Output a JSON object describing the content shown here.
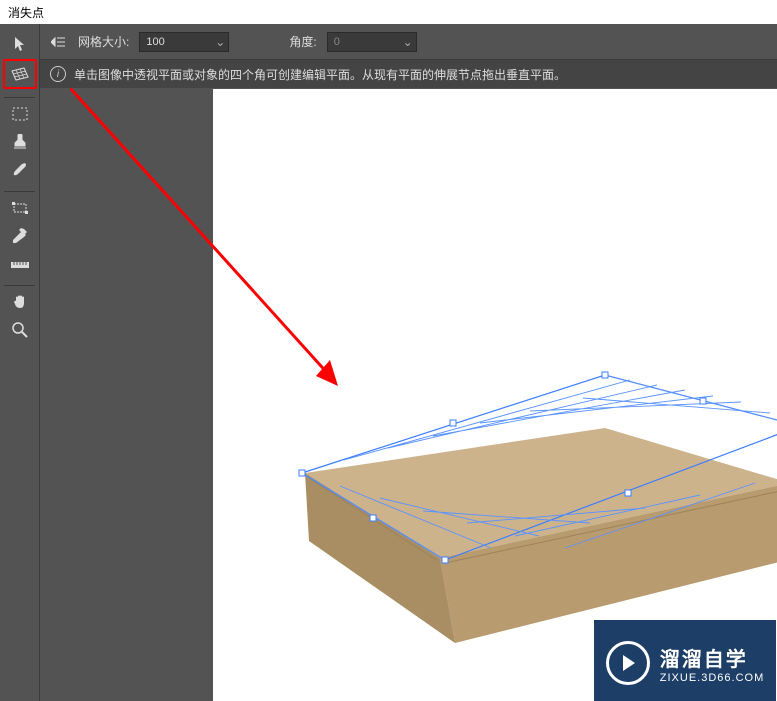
{
  "title": "消失点",
  "options": {
    "grid_label": "网格大小:",
    "grid_value": "100",
    "angle_label": "角度:",
    "angle_value": "0"
  },
  "info": {
    "text": "单击图像中透视平面或对象的四个角可创建编辑平面。从现有平面的伸展节点拖出垂直平面。"
  },
  "watermark": {
    "brand": "溜溜自学",
    "domain": "ZIXUE.3D66.COM"
  },
  "tools": [
    {
      "name": "edit-plane-tool",
      "icon": "cursor"
    },
    {
      "name": "create-plane-tool",
      "icon": "grid",
      "highlighted": true
    },
    {
      "name": "marquee-tool",
      "icon": "marquee"
    },
    {
      "name": "stamp-tool",
      "icon": "stamp"
    },
    {
      "name": "brush-tool",
      "icon": "brush"
    },
    {
      "name": "transform-tool",
      "icon": "transform"
    },
    {
      "name": "eyedropper-tool",
      "icon": "eyedropper"
    },
    {
      "name": "measure-tool",
      "icon": "ruler"
    },
    {
      "name": "hand-tool",
      "icon": "hand"
    },
    {
      "name": "zoom-tool",
      "icon": "zoom"
    }
  ]
}
